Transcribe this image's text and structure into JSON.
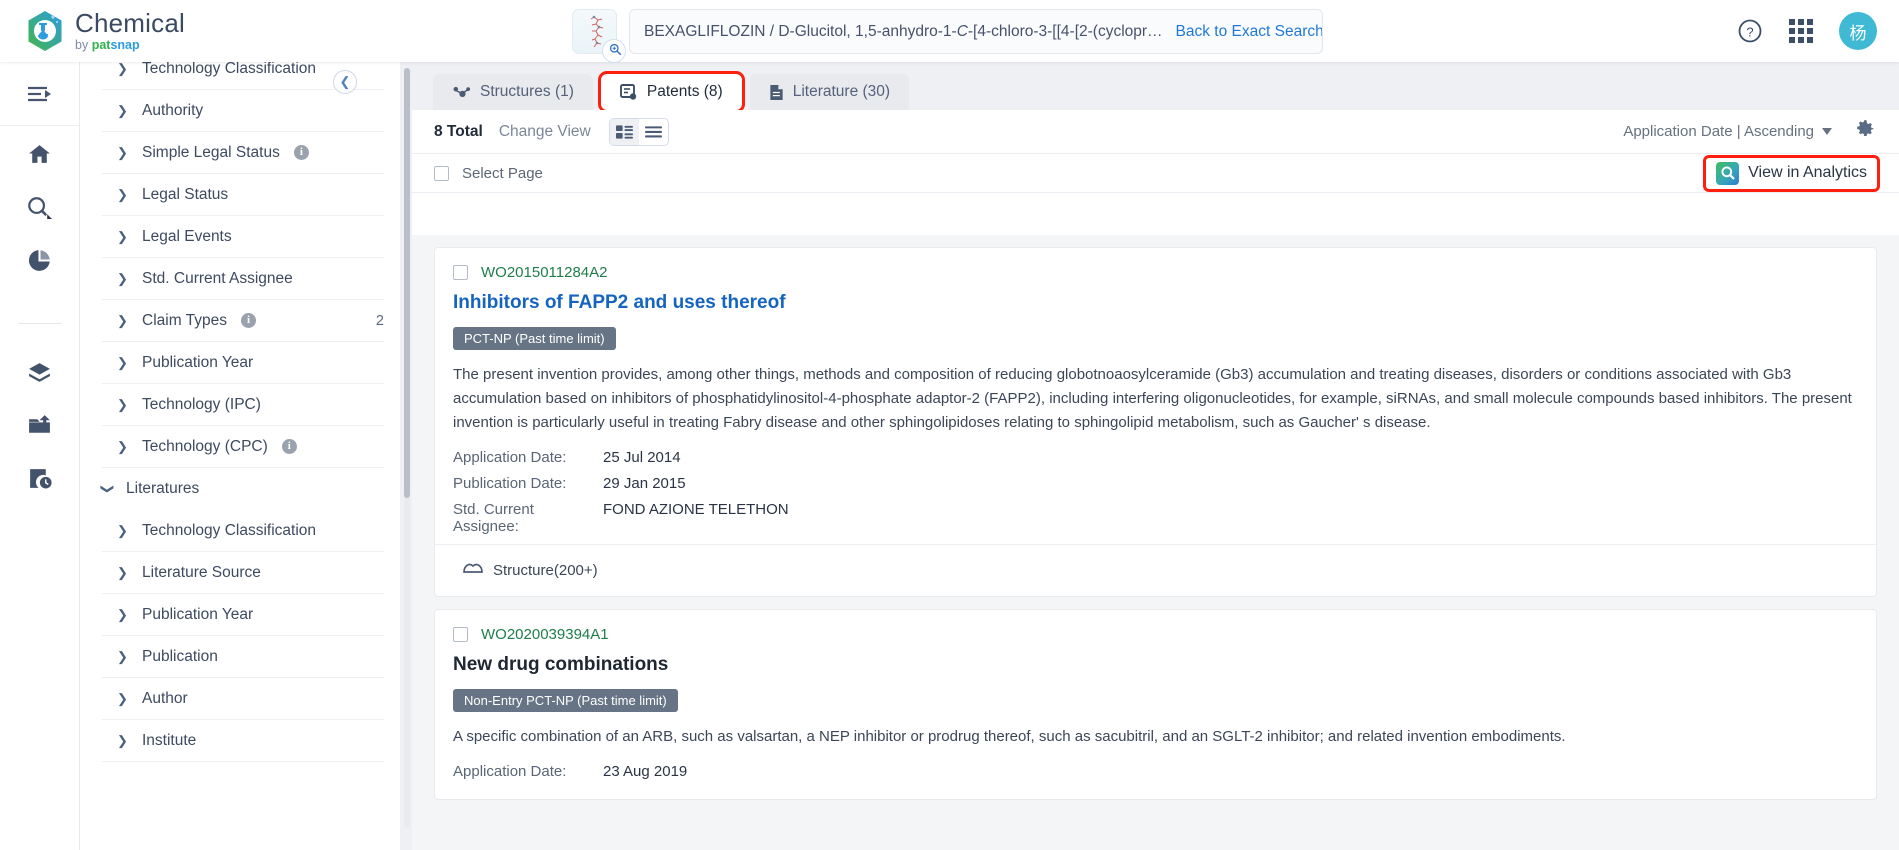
{
  "app": {
    "brand_title": "Chemical",
    "brand_by": "by ",
    "brand_pat": "pat",
    "brand_snap": "snap",
    "accent_color": "#1565c0",
    "highlight_color": "#ff1f0f",
    "avatar_initial": "杨"
  },
  "search": {
    "query": "BEXAGLIFLOZIN / D-Glucitol, 1,5-anhydro-1-",
    "query_italic": "C",
    "query_tail": "-[4-chloro-3-[[4-[2-(cyclopr…",
    "back_to_exact": "Back to Exact Search",
    "structure_thumb_icon": "molecule-structure-icon",
    "magnify_badge_icon": "magnifier-icon"
  },
  "topright": {
    "help_icon": "help-circle-icon",
    "apps_icon": "app-grid-icon",
    "avatar_icon": "user-avatar"
  },
  "rail": {
    "toggle_icon": "expand-sidebar-icon",
    "items": [
      {
        "name": "home-icon",
        "label": "Home"
      },
      {
        "name": "search-icon",
        "label": "Search"
      },
      {
        "name": "analytics-pie-icon",
        "label": "Analytics"
      },
      {
        "name": "workspace-box-icon",
        "label": "Workspace"
      },
      {
        "name": "export-folder-icon",
        "label": "Export"
      },
      {
        "name": "history-report-icon",
        "label": "History"
      }
    ]
  },
  "filters": {
    "rows": [
      {
        "label": "Technology Classification",
        "info": false,
        "count": "",
        "type": "child",
        "clipped": true
      },
      {
        "label": "Authority",
        "info": false,
        "count": "",
        "type": "child"
      },
      {
        "label": "Simple Legal Status",
        "info": true,
        "count": "",
        "type": "child"
      },
      {
        "label": "Legal Status",
        "info": false,
        "count": "",
        "type": "child"
      },
      {
        "label": "Legal Events",
        "info": false,
        "count": "",
        "type": "child"
      },
      {
        "label": "Std. Current Assignee",
        "info": false,
        "count": "",
        "type": "child"
      },
      {
        "label": "Claim Types",
        "info": true,
        "count": "2",
        "type": "child"
      },
      {
        "label": "Publication Year",
        "info": false,
        "count": "",
        "type": "child"
      },
      {
        "label": "Technology (IPC)",
        "info": false,
        "count": "",
        "type": "child"
      },
      {
        "label": "Technology (CPC)",
        "info": true,
        "count": "",
        "type": "child"
      },
      {
        "label": "Literatures",
        "info": false,
        "count": "",
        "type": "group"
      },
      {
        "label": "Technology Classification",
        "info": false,
        "count": "",
        "type": "child"
      },
      {
        "label": "Literature Source",
        "info": false,
        "count": "",
        "type": "child"
      },
      {
        "label": "Publication Year",
        "info": false,
        "count": "",
        "type": "child"
      },
      {
        "label": "Publication",
        "info": false,
        "count": "",
        "type": "child"
      },
      {
        "label": "Author",
        "info": false,
        "count": "",
        "type": "child"
      },
      {
        "label": "Institute",
        "info": false,
        "count": "",
        "type": "child"
      }
    ],
    "collapse_icon": "chevron-left-icon"
  },
  "tabs": [
    {
      "label": "Structures (1)",
      "icon": "structures-icon",
      "active": false,
      "highlight": false
    },
    {
      "label": "Patents (8)",
      "icon": "patents-icon",
      "active": true,
      "highlight": true
    },
    {
      "label": "Literature (30)",
      "icon": "literature-icon",
      "active": false,
      "highlight": false
    }
  ],
  "toolbar": {
    "total": "8 Total",
    "change_view": "Change View",
    "view_card_icon": "card-view-icon",
    "view_list_icon": "list-view-icon",
    "sort_label": "Application Date | Ascending",
    "sort_caret_icon": "caret-down-icon",
    "settings_icon": "gear-icon"
  },
  "select_row": {
    "select_page": "Select Page",
    "analytics_label": "View in Analytics",
    "analytics_icon": "analytics-search-icon"
  },
  "results": [
    {
      "pub_no": "WO2015011284A2",
      "title": "Inhibitors of FAPP2 and uses thereof",
      "title_style": "link",
      "badge": "PCT-NP (Past time limit)",
      "abstract": "The present invention provides, among other things, methods and composition of reducing globotnoaosylceramide (Gb3) accumulation and treating diseases, disorders or conditions associated with Gb3 accumulation based on inhibitors of phosphatidylinositol-4-phosphate adaptor-2 (FAPP2), including interfering oligonucleotides, for example, siRNAs, and small molecule compounds based inhibitors. The present invention is particularly useful in treating Fabry disease and other sphingolipidoses relating to sphingolipid metabolism, such as Gaucher' s disease.",
      "fields": [
        {
          "key": "Application Date:",
          "value": "25 Jul 2014"
        },
        {
          "key": "Publication Date:",
          "value": "29 Jan 2015"
        },
        {
          "key": "Std. Current Assignee:",
          "value": "FOND AZIONE TELETHON"
        }
      ],
      "footer_label": "Structure(200+)",
      "footer_icon": "structure-icon"
    },
    {
      "pub_no": "WO2020039394A1",
      "title": "New drug combinations",
      "title_style": "dark",
      "badge": "Non-Entry PCT-NP (Past time limit)",
      "abstract": "A specific combination of an ARB, such as valsartan, a NEP inhibitor or prodrug thereof, such as sacubitril, and an SGLT-2 inhibitor; and related invention embodiments.",
      "fields": [
        {
          "key": "Application Date:",
          "value": "23 Aug 2019"
        }
      ],
      "footer_label": "",
      "footer_icon": ""
    }
  ]
}
